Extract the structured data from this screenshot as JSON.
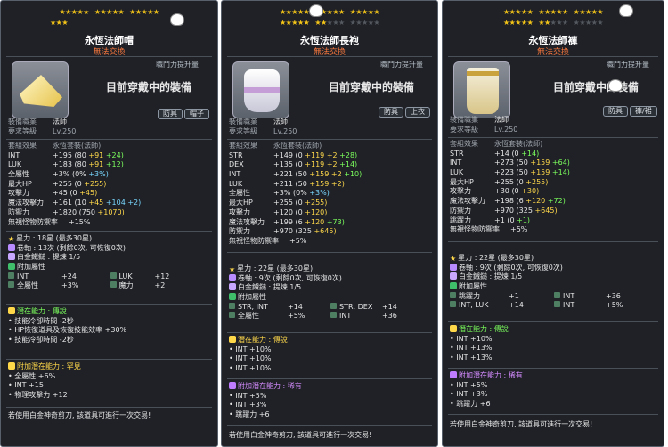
{
  "tooltips": [
    {
      "title": "永恆法師帽",
      "untradeable": "無法交換",
      "power_label": "職鬥力提升量",
      "equipped_text": "目前穿戴中的裝備",
      "badges": [
        "防具",
        "帽子"
      ],
      "job_label": "裝備職業",
      "job": "法師",
      "req_label": "要求等級",
      "req": "Lv.250",
      "set_label": "套組效果",
      "set": "永恆套裝(法師)",
      "stats": [
        {
          "name": "INT",
          "base": "+195",
          "a": "(80",
          "b": "+91",
          "c": "+24)"
        },
        {
          "name": "LUK",
          "base": "+183",
          "a": "(80",
          "b": "+91",
          "c": "+12)"
        },
        {
          "name": "全屬性",
          "base": "+3%",
          "a": "(0%",
          "b": "+3%)",
          "c": ""
        },
        {
          "name": "最大HP",
          "base": "+255",
          "a": "(0",
          "b": "+255)",
          "c": ""
        },
        {
          "name": "攻擊力",
          "base": "+45",
          "a": "(0",
          "b": "+45)",
          "c": ""
        },
        {
          "name": "魔法攻擊力",
          "base": "+161",
          "a": "(10",
          "b": "+45",
          "c": "+104 +2)"
        },
        {
          "name": "防禦力",
          "base": "+1820",
          "a": "(750",
          "b": "+1070)",
          "c": ""
        },
        {
          "name": "無視怪物防禦率",
          "base": "+15%",
          "a": "",
          "b": "",
          "c": ""
        }
      ],
      "star_line": "星力 : 18星 (最多30星)",
      "scroll_line": "卷軸 : 13次 (剩餘0次, 可恢復0次)",
      "hammer_line": "白金鐵鎚 : 提煉 1/5",
      "add_label": "附加屬性",
      "add_stats": [
        [
          "INT",
          "+24",
          "LUK",
          "+12"
        ],
        [
          "全屬性",
          "+3%",
          "魔力",
          "+2"
        ]
      ],
      "pot_label": "潛在能力 : 傳說",
      "pot_lines": [
        "技能冷卻時間 -2秒",
        "HP恢復道具及恢復技能效率 +30%",
        "技能冷卻時間 -2秒"
      ],
      "addpot_label": "附加潛在能力 : 罕見",
      "addpot_lines": [
        "全屬性 +6%",
        "INT +15",
        "物理攻擊力 +12"
      ],
      "footer": "若使用白金神奇剪刀, 該道具可進行一次交易!"
    },
    {
      "title": "永恆法師長袍",
      "untradeable": "無法交換",
      "power_label": "職鬥力提升量",
      "equipped_text": "目前穿戴中的裝備",
      "badges": [
        "防具",
        "上衣"
      ],
      "job_label": "裝備職業",
      "job": "法師",
      "req_label": "要求等級",
      "req": "Lv.250",
      "set_label": "套組效果",
      "set": "永恆套裝(法師)",
      "stats": [
        {
          "name": "STR",
          "base": "+149",
          "a": "(0",
          "b": "+119 +2",
          "c": "+28)"
        },
        {
          "name": "DEX",
          "base": "+135",
          "a": "(0",
          "b": "+119 +2",
          "c": "+14)"
        },
        {
          "name": "INT",
          "base": "+221",
          "a": "(50",
          "b": "+159 +2",
          "c": "+10)"
        },
        {
          "name": "LUK",
          "base": "+211",
          "a": "(50",
          "b": "+159 +2)",
          "c": ""
        },
        {
          "name": "全屬性",
          "base": "+3%",
          "a": "(0%",
          "b": "+3%)",
          "c": ""
        },
        {
          "name": "最大HP",
          "base": "+255",
          "a": "(0",
          "b": "+255)",
          "c": ""
        },
        {
          "name": "攻擊力",
          "base": "+120",
          "a": "(0",
          "b": "+120)",
          "c": ""
        },
        {
          "name": "魔法攻擊力",
          "base": "+199",
          "a": "(6",
          "b": "+120",
          "c": "+73)"
        },
        {
          "name": "防禦力",
          "base": "+970",
          "a": "(325",
          "b": "+645)",
          "c": ""
        },
        {
          "name": "無視怪物防禦率",
          "base": "+5%",
          "a": "",
          "b": "",
          "c": ""
        }
      ],
      "star_line": "星力 : 22星 (最多30星)",
      "scroll_line": "卷軸 : 9次 (剩餘0次, 可恢復0次)",
      "hammer_line": "白金鐵鎚 : 提煉 1/5",
      "add_label": "附加屬性",
      "add_stats": [
        [
          "STR, INT",
          "+14",
          "STR, DEX",
          "+14"
        ],
        [
          "全屬性",
          "+5%",
          "INT",
          "+36"
        ]
      ],
      "pot_label": "潛在能力 : 傳說",
      "pot_lines": [
        "INT +10%",
        "INT +10%",
        "INT +10%"
      ],
      "addpot_label": "附加潛在能力 : 稀有",
      "addpot_lines": [
        "INT +5%",
        "INT +3%",
        "跳躍力 +6"
      ],
      "footer": "若使用白金神奇剪刀, 該道具可進行一次交易!"
    },
    {
      "title": "永恆法師褲",
      "untradeable": "無法交換",
      "power_label": "職鬥力提升量",
      "equipped_text": "目前穿戴中的裝備",
      "badges": [
        "防具",
        "褲/裙"
      ],
      "job_label": "裝備職業",
      "job": "法師",
      "req_label": "要求等級",
      "req": "Lv.250",
      "set_label": "套組效果",
      "set": "永恆套裝(法師)",
      "stats": [
        {
          "name": "STR",
          "base": "+14",
          "a": "(0",
          "b": "+14)",
          "c": ""
        },
        {
          "name": "INT",
          "base": "+273",
          "a": "(50",
          "b": "+159",
          "c": "+64)"
        },
        {
          "name": "LUK",
          "base": "+223",
          "a": "(50",
          "b": "+159",
          "c": "+14)"
        },
        {
          "name": "最大HP",
          "base": "+255",
          "a": "(0",
          "b": "+255)",
          "c": ""
        },
        {
          "name": "攻擊力",
          "base": "+30",
          "a": "(0",
          "b": "+30)",
          "c": ""
        },
        {
          "name": "魔法攻擊力",
          "base": "+198",
          "a": "(6",
          "b": "+120",
          "c": "+72)"
        },
        {
          "name": "防禦力",
          "base": "+970",
          "a": "(325",
          "b": "+645)",
          "c": ""
        },
        {
          "name": "跳躍力",
          "base": "+1",
          "a": "(0",
          "b": "+1)",
          "c": ""
        },
        {
          "name": "無視怪物防禦率",
          "base": "+5%",
          "a": "",
          "b": "",
          "c": ""
        }
      ],
      "star_line": "星力 : 22星 (最多30星)",
      "scroll_line": "卷軸 : 9次 (剩餘0次, 可恢復0次)",
      "hammer_line": "白金鐵鎚 : 提煉 1/5",
      "add_label": "附加屬性",
      "add_stats": [
        [
          "跳躍力",
          "+1",
          "INT",
          "+36"
        ],
        [
          "INT, LUK",
          "+14",
          "INT",
          "+5%"
        ]
      ],
      "pot_label": "潛在能力 : 傳說",
      "pot_lines": [
        "INT +10%",
        "INT +13%",
        "INT +13%"
      ],
      "addpot_label": "附加潛在能力 : 稀有",
      "addpot_lines": [
        "INT +5%",
        "INT +3%",
        "跳躍力 +6"
      ],
      "footer": "若使用白金神奇剪刀, 該道具可進行一次交易!"
    }
  ]
}
